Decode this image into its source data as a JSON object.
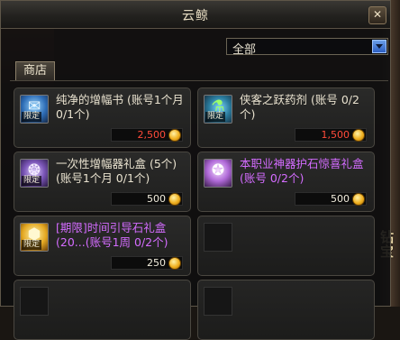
{
  "window": {
    "title": "云鲸"
  },
  "filter": {
    "selected": "全部"
  },
  "tabs": [
    {
      "label": "商店"
    }
  ],
  "items": [
    {
      "name": "纯净的增幅书 (账号1个月 0/1个)",
      "badge": "限定",
      "price": "2,500",
      "price_color": "red",
      "icon": "blue-scroll-icon"
    },
    {
      "name": "侠客之跃药剂 (账号 0/2个)",
      "badge": "限定",
      "price": "1,500",
      "price_color": "red",
      "icon": "green-potion-icon"
    },
    {
      "name": "一次性增幅器礼盒 (5个)(账号1个月 0/1个)",
      "badge": "限定",
      "price": "500",
      "price_color": "white",
      "icon": "purple-box-icon"
    },
    {
      "name": "本职业神器护石惊喜礼盒(账号 0/2个)",
      "badge": "",
      "price": "500",
      "price_color": "white",
      "icon": "purple-chest-icon",
      "name_color": "purple"
    },
    {
      "name": "[期限]时间引导石礼盒(20...(账号1周 0/2个)",
      "badge": "限定",
      "price": "250",
      "price_color": "white",
      "icon": "gold-stone-icon",
      "name_color": "purple"
    }
  ],
  "background": {
    "glyph_text": "钻\n宝"
  },
  "colors": {
    "accent_blue": "#3b6fd4",
    "price_red": "#ff4b3a",
    "epic_purple": "#d46cff"
  }
}
